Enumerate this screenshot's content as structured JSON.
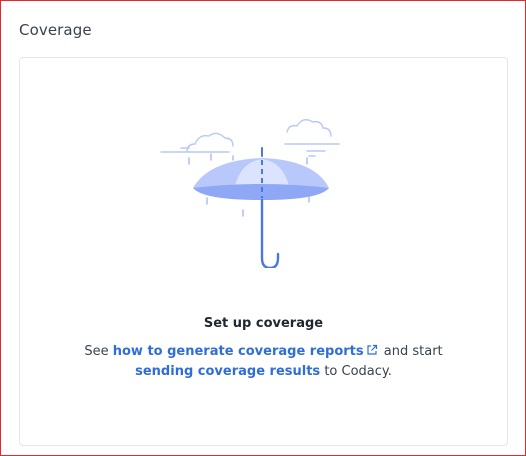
{
  "panel": {
    "title": "Coverage"
  },
  "empty_state": {
    "illustration_icon": "umbrella-rain-icon",
    "heading": "Set up coverage",
    "text_see": "See",
    "link_generate": "how to generate coverage reports",
    "external_icon": "external-link-icon",
    "text_and_start": "and start",
    "link_sending": "sending coverage results",
    "text_to_codacy": "to Codacy."
  },
  "colors": {
    "frame_border": "#e8262b",
    "link": "#2f6ed9",
    "umbrella_canopy": "#8fa8f5",
    "umbrella_handle": "#4a78e0"
  }
}
